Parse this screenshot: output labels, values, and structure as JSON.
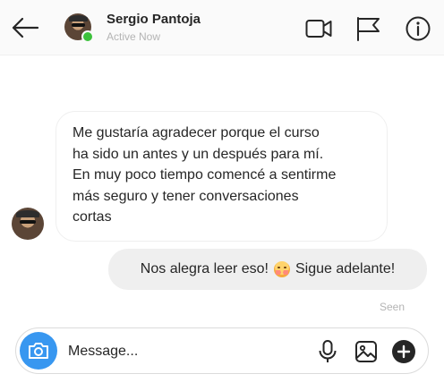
{
  "header": {
    "back_icon": "arrow-left-icon",
    "user_name": "Sergio Pantoja",
    "status": "Active Now",
    "actions": [
      {
        "name": "video-call",
        "icon": "video-camera-icon"
      },
      {
        "name": "report",
        "icon": "flag-icon"
      },
      {
        "name": "details",
        "icon": "info-icon"
      }
    ]
  },
  "messages": [
    {
      "direction": "incoming",
      "lines": [
        "Me gustaría agradecer porque el curso",
        "ha sido un antes y un después para mí.",
        "En muy poco tiempo comencé a sentirme",
        "más seguro y tener conversaciones",
        "cortas"
      ]
    },
    {
      "direction": "outgoing",
      "text_before": "Nos alegra leer eso!",
      "emoji": "smiling-face-with-smiling-eyes",
      "text_after": "Sigue adelante!"
    }
  ],
  "seen_label": "Seen",
  "composer": {
    "placeholder": "Message...",
    "camera_icon": "camera-icon",
    "mic_icon": "microphone-icon",
    "gallery_icon": "image-icon",
    "plus_icon": "plus-circle-icon"
  },
  "colors": {
    "accent": "#3897f0",
    "online": "#3cc13b",
    "outgoing_bubble": "#efefef",
    "muted_text": "#b4b4b4"
  }
}
